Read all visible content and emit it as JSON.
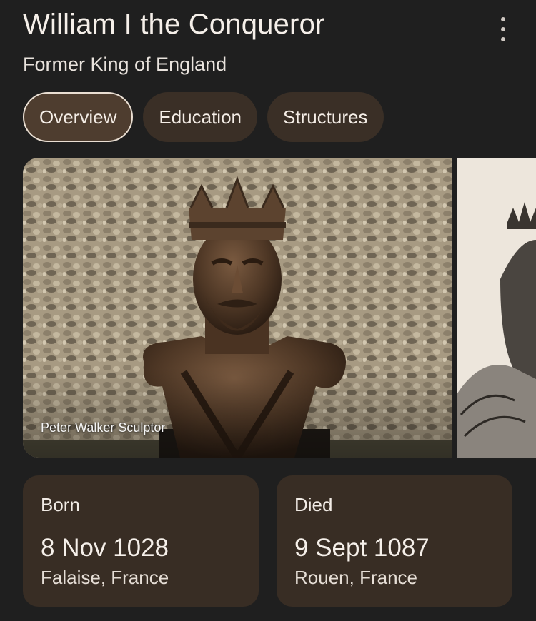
{
  "header": {
    "title": "William I the Conqueror",
    "subtitle": "Former King of England",
    "more_icon": "more-vert-icon"
  },
  "tabs": [
    {
      "label": "Overview",
      "active": true
    },
    {
      "label": "Education",
      "active": false
    },
    {
      "label": "Structures",
      "active": false
    }
  ],
  "images": {
    "main_caption": "Peter Walker Sculptor"
  },
  "facts": [
    {
      "label": "Born",
      "date": "8 Nov 1028",
      "place": "Falaise, France"
    },
    {
      "label": "Died",
      "date": "9 Sept 1087",
      "place": "Rouen, France"
    }
  ],
  "colors": {
    "background": "#1f1f1f",
    "chip": "#3a2f26",
    "chip_active": "#4e3d2f",
    "card": "#382d24"
  }
}
